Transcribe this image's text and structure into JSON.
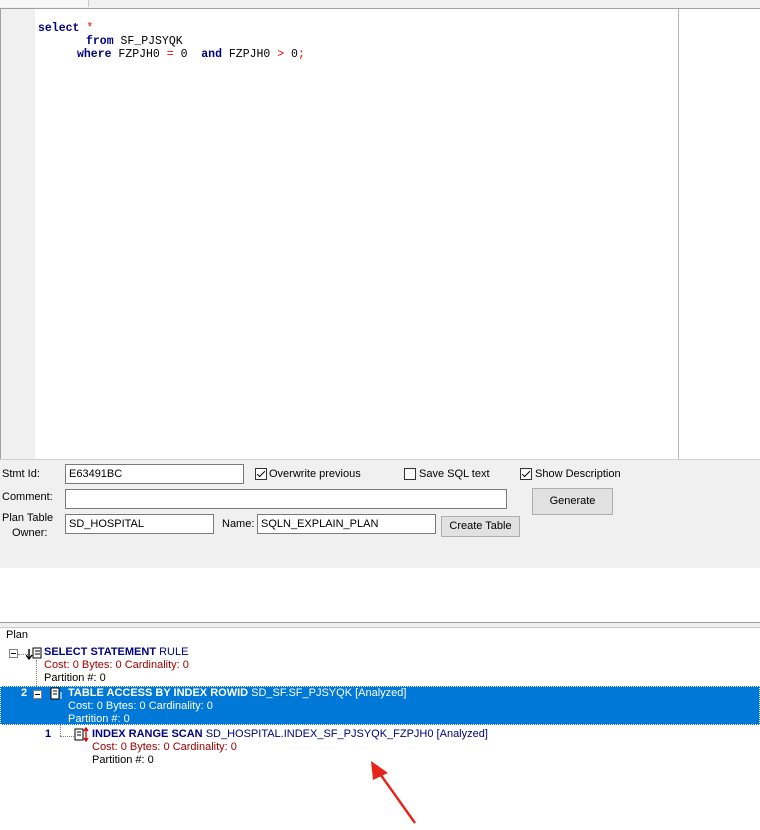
{
  "editor": {
    "line1": {
      "kw": "select",
      "op": "*"
    },
    "line2": {
      "kw": "from",
      "table": "SF_PJSYQK"
    },
    "line3": {
      "kw_where": "where",
      "col1": "FZPJH0",
      "op1": "=",
      "val1": "0",
      "kw_and": "and",
      "col2": "FZPJH0",
      "op2": ">",
      "val2": "0",
      "end": ";"
    }
  },
  "form": {
    "stmt_id_label": "Stmt Id:",
    "stmt_id_value": "E63491BC",
    "overwrite_label": "Overwrite previous",
    "overwrite_checked": true,
    "save_sql_label": "Save SQL text",
    "save_sql_checked": false,
    "show_desc_label": "Show Description",
    "show_desc_checked": true,
    "comment_label": "Comment:",
    "comment_value": "",
    "generate_label": "Generate",
    "plan_table_label_1": "Plan Table",
    "plan_table_label_2": "Owner:",
    "owner_value": "SD_HOSPITAL",
    "name_label": "Name:",
    "name_value": "SQLN_EXPLAIN_PLAN",
    "create_table_label": "Create Table"
  },
  "plan": {
    "header": "Plan",
    "nodes": [
      {
        "id": "",
        "op": "SELECT STATEMENT",
        "obj": "RULE",
        "stats": "Cost: 0  Bytes: 0  Cardinality: 0",
        "partition": "Partition #: 0"
      },
      {
        "id": "2",
        "op": "TABLE ACCESS BY INDEX ROWID",
        "obj": "SD_SF.SF_PJSYQK [Analyzed]",
        "stats": "Cost: 0  Bytes: 0  Cardinality: 0",
        "partition": "Partition #: 0"
      },
      {
        "id": "1",
        "op": "INDEX RANGE SCAN",
        "obj": "SD_HOSPITAL.INDEX_SF_PJSYQK_FZPJH0 [Analyzed]",
        "stats": "Cost: 0  Bytes: 0  Cardinality: 0",
        "partition": "Partition #: 0"
      }
    ]
  },
  "colors": {
    "selection": "#0078d7",
    "keyword": "#000080",
    "operator": "#ff0000",
    "stats": "#a00000",
    "arrow": "#e8231a"
  },
  "icons": [
    "expand-toggle-icon",
    "select-statement-icon",
    "table-access-icon",
    "index-scan-icon",
    "annotation-arrow-icon"
  ]
}
